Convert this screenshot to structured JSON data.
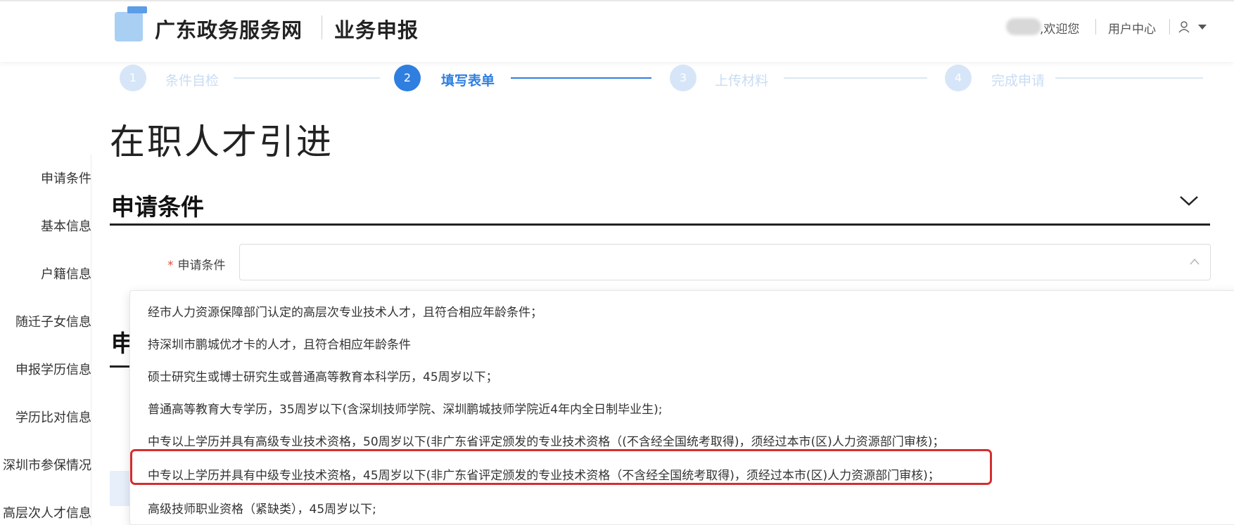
{
  "header": {
    "site_name": "广东政务服务网",
    "sub_name": "业务申报",
    "welcome": ",欢迎您",
    "user_center": "用户中心"
  },
  "steps": [
    {
      "number": "1",
      "label": "条件自检",
      "state": "pending"
    },
    {
      "number": "2",
      "label": "填写表单",
      "state": "active"
    },
    {
      "number": "3",
      "label": "上传材料",
      "state": "pending"
    },
    {
      "number": "4",
      "label": "完成申请",
      "state": "pending"
    }
  ],
  "page_title": "在职人才引进",
  "left_nav": [
    "申请条件",
    "基本信息",
    "户籍信息",
    "随迁子女信息",
    "申报学历信息",
    "学历比对信息",
    "深圳市参保情况",
    "高层次人才信息"
  ],
  "section": {
    "title": "申请条件",
    "field_label": "申请条件",
    "required_mark": "*",
    "select_value": ""
  },
  "background_section_partial": "申",
  "dropdown_options": [
    "经市人力资源保障部门认定的高层次专业技术人才，且符合相应年龄条件；",
    "持深圳市鹏城优才卡的人才，且符合相应年龄条件",
    "硕士研究生或博士研究生或普通高等教育本科学历，45周岁以下；",
    "普通高等教育大专学历，35周岁以下(含深圳技师学院、深圳鹏城技师学院近4年内全日制毕业生);",
    "中专以上学历并具有高级专业技术资格，50周岁以下(非广东省评定颁发的专业技术资格（(不含经全国统考取得)，须经过本市(区)人力资源部门审核)；",
    "中专以上学历并具有中级专业技术资格，45周岁以下(非广东省评定颁发的专业技术资格（不含经全国统考取得)，须经过本市(区)人力资源部门审核)；",
    "高级技师职业资格（紧缺类），45周岁以下;"
  ],
  "highlighted_option_index": 5,
  "colors": {
    "active_step": "#2f7fe0",
    "pending_step": "#cfe1f7",
    "pending_label": "#c9dcf3",
    "highlight_border": "#d32f2f",
    "required": "#e74c3c",
    "logo": "#a9cff3"
  }
}
